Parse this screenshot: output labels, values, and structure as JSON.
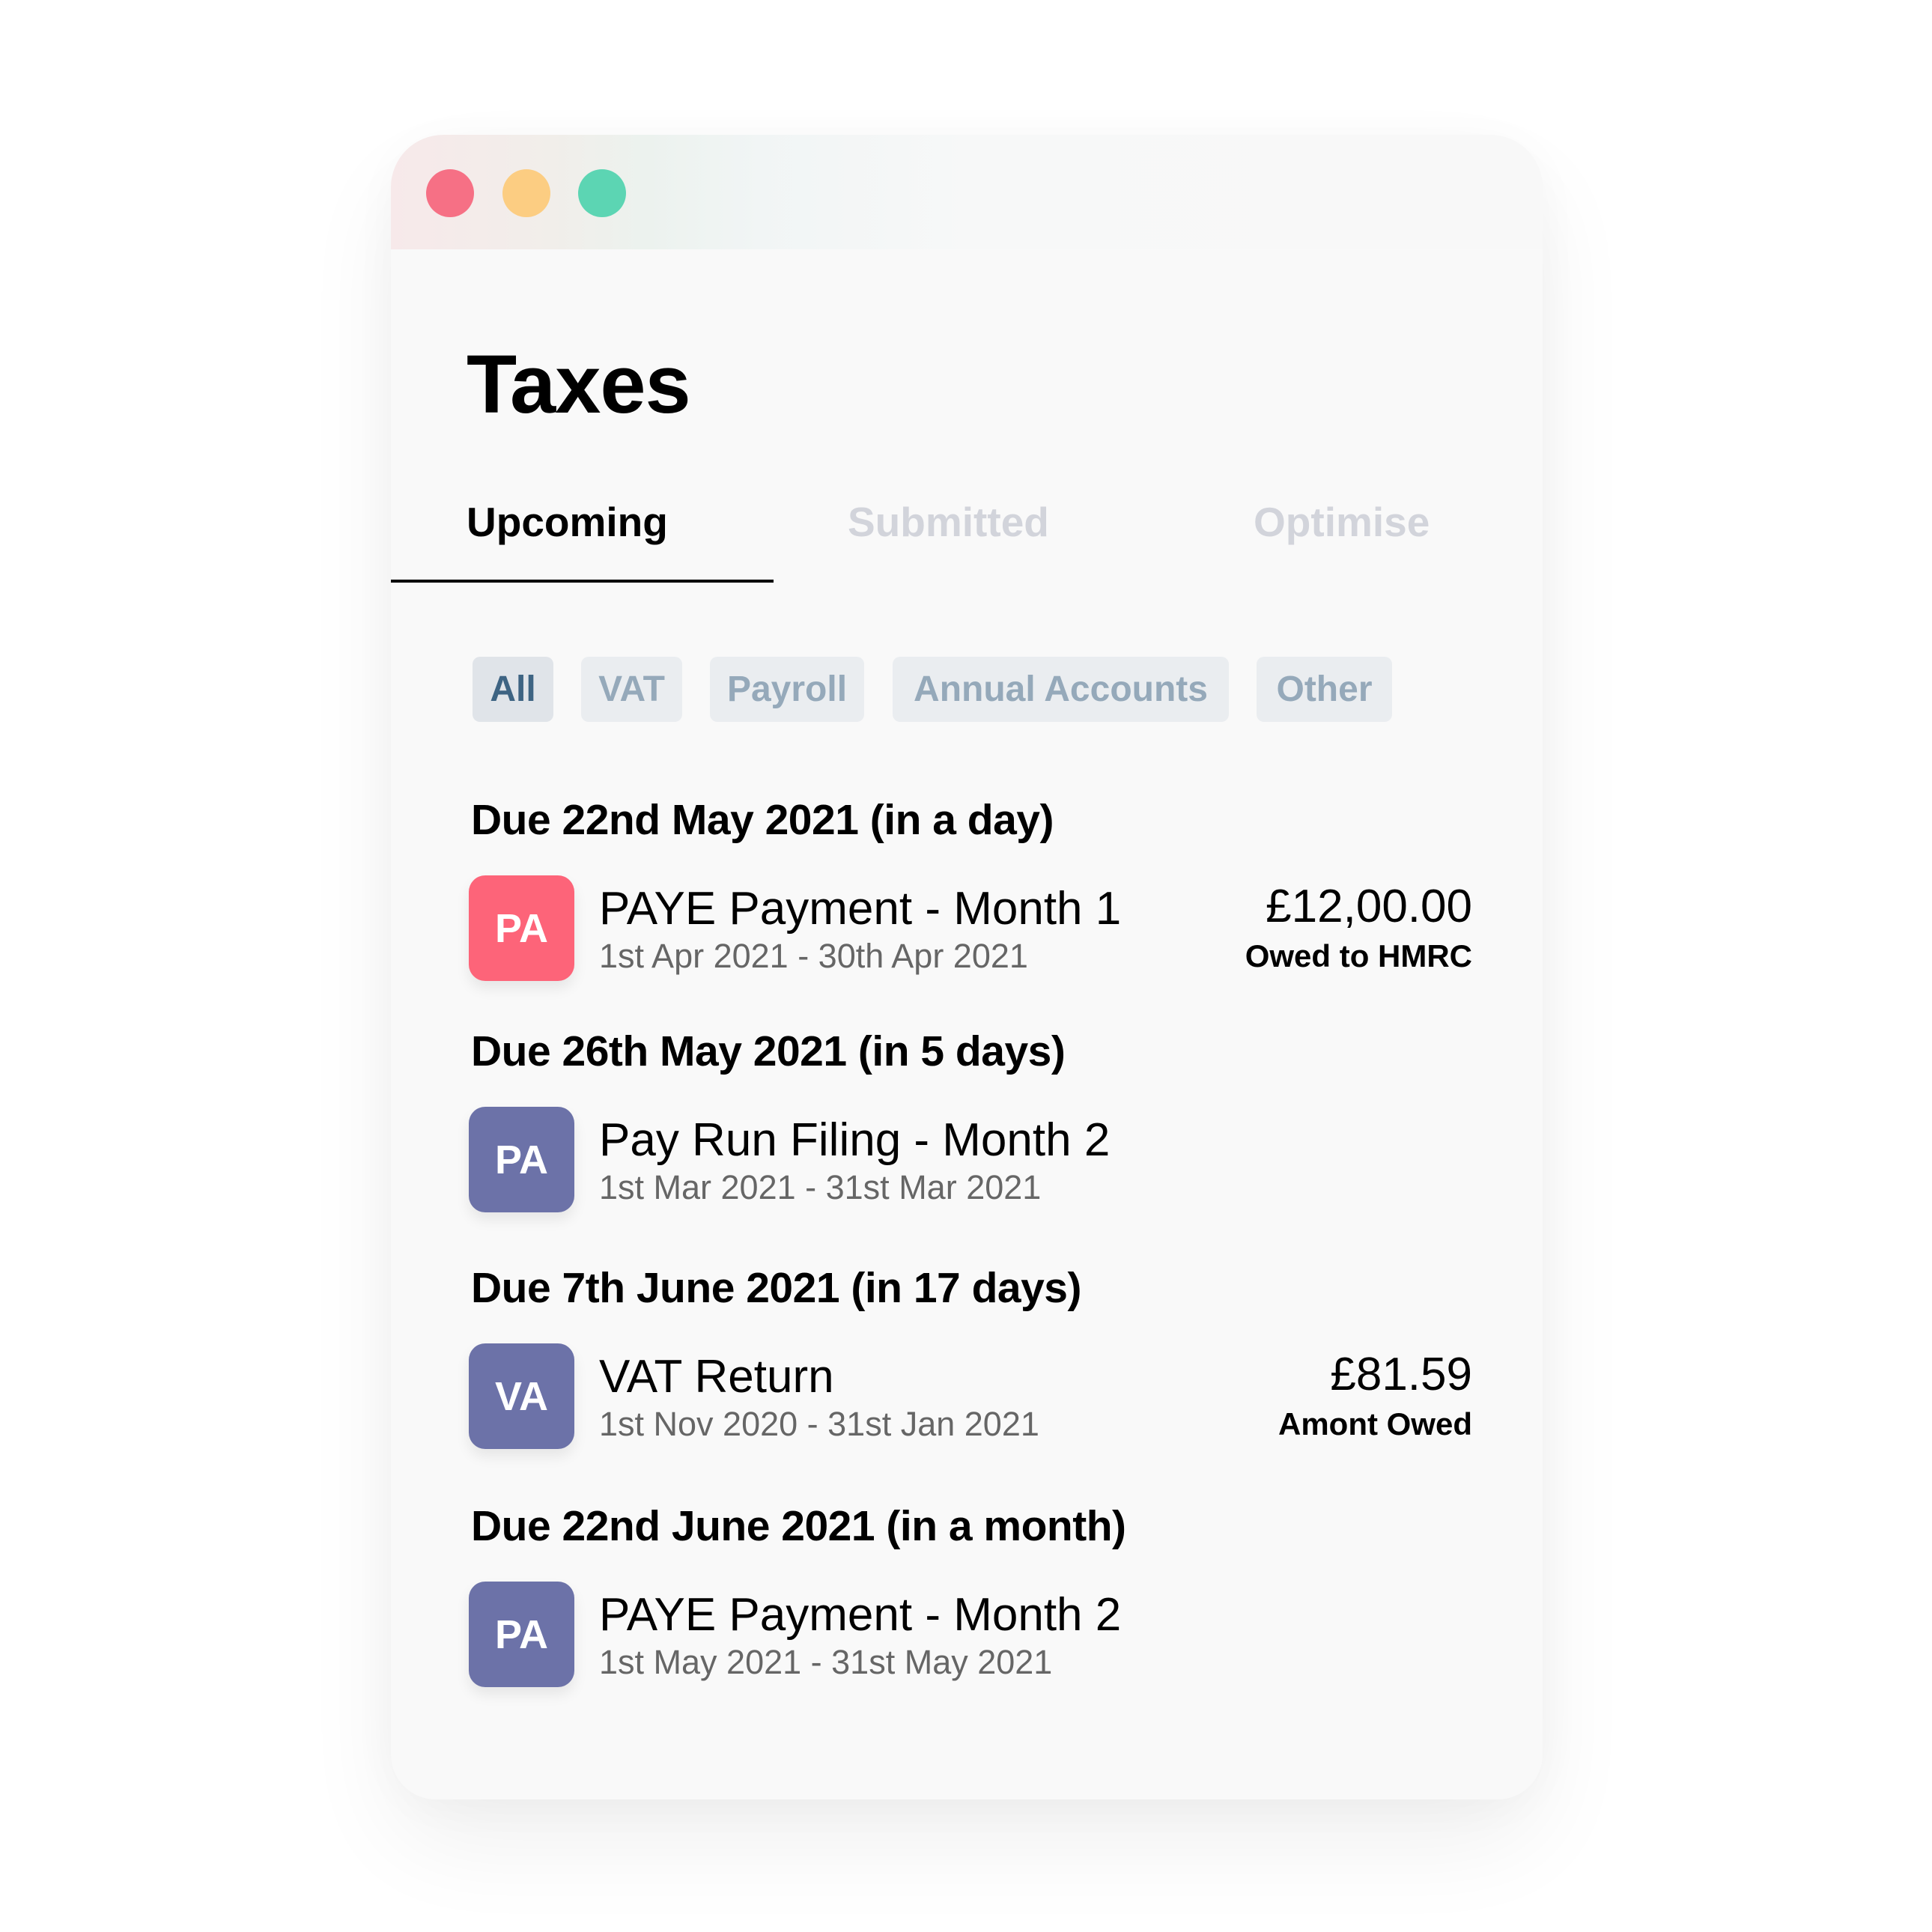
{
  "window": {
    "controls": [
      {
        "name": "close",
        "color": "#F67085"
      },
      {
        "name": "minimize",
        "color": "#FCCD82"
      },
      {
        "name": "maximize",
        "color": "#5CD5B3"
      }
    ]
  },
  "page": {
    "title": "Taxes"
  },
  "tabs": [
    {
      "label": "Upcoming",
      "active": true
    },
    {
      "label": "Submitted",
      "active": false
    },
    {
      "label": "Optimise",
      "active": false
    }
  ],
  "filters": [
    {
      "label": "All",
      "active": true
    },
    {
      "label": "VAT",
      "active": false
    },
    {
      "label": "Payroll",
      "active": false
    },
    {
      "label": "Annual Accounts",
      "active": false
    },
    {
      "label": "Other",
      "active": false
    }
  ],
  "sections": [
    {
      "heading": "Due 22nd May 2021 (in a day)",
      "item": {
        "avatar": "PA",
        "avatar_color": "#FD6479",
        "title": "PAYE Payment - Month 1",
        "period": "1st Apr 2021 - 30th Apr 2021",
        "amount": "£12,00.00",
        "amount_label": "Owed to HMRC"
      }
    },
    {
      "heading": "Due 26th May 2021 (in 5 days)",
      "item": {
        "avatar": "PA",
        "avatar_color": "#6C72A8",
        "title": "Pay Run Filing - Month 2",
        "period": "1st Mar 2021  -  31st Mar 2021"
      }
    },
    {
      "heading": "Due 7th June 2021 (in 17 days)",
      "item": {
        "avatar": "VA",
        "avatar_color": "#6C72A8",
        "title": "VAT Return",
        "period": "1st Nov 2020  -  31st Jan 2021",
        "amount": "£81.59",
        "amount_label": "Amont Owed"
      }
    },
    {
      "heading": "Due 22nd June 2021 (in a month)",
      "item": {
        "avatar": "PA",
        "avatar_color": "#6C72A8",
        "title": "PAYE Payment - Month 2",
        "period": "1st May 2021  -  31st May 2021"
      }
    }
  ]
}
